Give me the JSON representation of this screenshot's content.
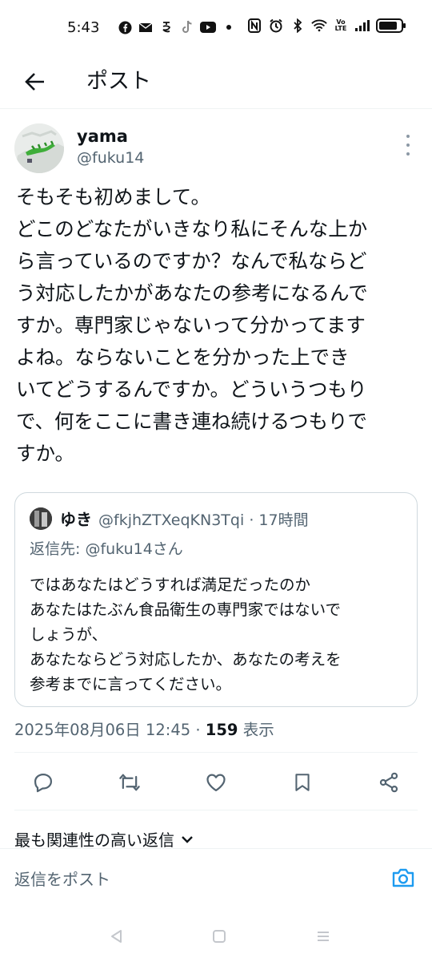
{
  "status_bar": {
    "time": "5:43",
    "left_icons": [
      "facebook-icon",
      "mail-icon",
      "app-icon",
      "tiktok-icon",
      "youtube-icon",
      "dot-icon"
    ],
    "right_icons": [
      "nfc-icon",
      "alarm-icon",
      "bluetooth-icon",
      "wifi-icon",
      "volte-icon",
      "signal-icon",
      "battery-icon"
    ],
    "volte_text_top": "Vo",
    "volte_text_bottom": "LTE",
    "battery_level": 0.85
  },
  "header": {
    "title": "ポスト",
    "back_icon": "arrow-left-icon"
  },
  "tweet": {
    "display_name": "yama",
    "handle": "@fuku14",
    "body_lines": [
      "そもそも初めまして。",
      "どこのどなたがいきなり私にそんな上か",
      "ら言っているのですか？なんで私ならど",
      "う対応したかがあなたの参考になるんで",
      "すか。専門家じゃないって分かってます",
      "よね。ならないことを分かった上でき",
      "いてどうするんですか。どういうつもり",
      "で、何をここに書き連ね続けるつもりで",
      "すか。"
    ],
    "timestamp": "2025年08月06日 12:45",
    "separator": "·",
    "views_count": "159",
    "views_label": "表示"
  },
  "quote": {
    "display_name": "ゆき",
    "handle": "@fkjhZTXeqKN3Tqi",
    "separator": "·",
    "time_ago": "17時間",
    "reply_to": "返信先: @fuku14さん",
    "text_lines": [
      "ではあなたはどうすれば満足だったのか",
      "あなたはたぶん食品衛生の専門家ではないで",
      "しょうが、",
      "あなたならどう対応したか、あなたの考えを",
      "参考までに言ってください。"
    ]
  },
  "actions": [
    "reply-icon",
    "repost-icon",
    "like-icon",
    "bookmark-icon",
    "share-icon"
  ],
  "relevant_replies": {
    "label": "最も関連性の高い返信"
  },
  "reply_bar": {
    "placeholder": "返信をポスト"
  },
  "colors": {
    "text_primary": "#0f1419",
    "text_secondary": "#536471",
    "accent": "#1d9bf0",
    "border": "#cfd9de"
  }
}
